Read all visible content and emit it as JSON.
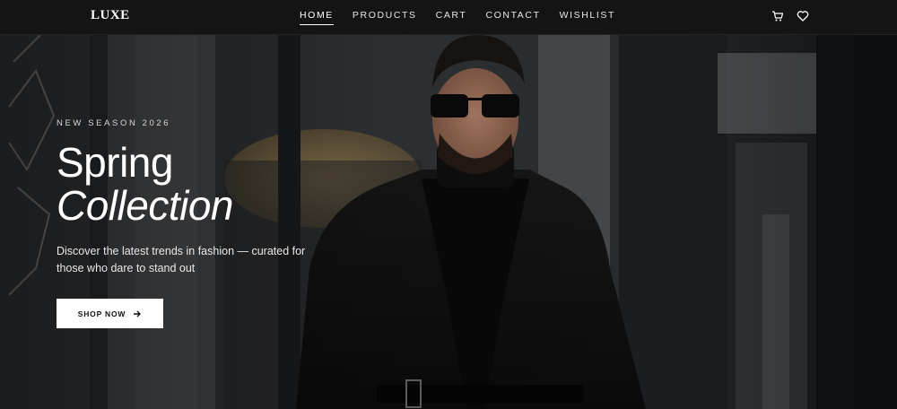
{
  "brand": {
    "logo": "LUXE"
  },
  "nav": {
    "links": [
      {
        "label": "HOME",
        "active": true
      },
      {
        "label": "PRODUCTS",
        "active": false
      },
      {
        "label": "CART",
        "active": false
      },
      {
        "label": "CONTACT",
        "active": false
      },
      {
        "label": "WISHLIST",
        "active": false
      }
    ],
    "icons": [
      "cart-icon",
      "heart-icon"
    ]
  },
  "hero": {
    "eyebrow": "NEW SEASON 2026",
    "title_line1": "Spring",
    "title_line2": "Collection",
    "description": "Discover the latest trends in fashion — curated for those who dare to stand out",
    "cta_label": "SHOP NOW",
    "cta_icon": "arrow-right-icon"
  },
  "colors": {
    "nav_bg": "#141414",
    "text": "#ffffff",
    "button_bg": "#ffffff",
    "button_text": "#111111"
  }
}
